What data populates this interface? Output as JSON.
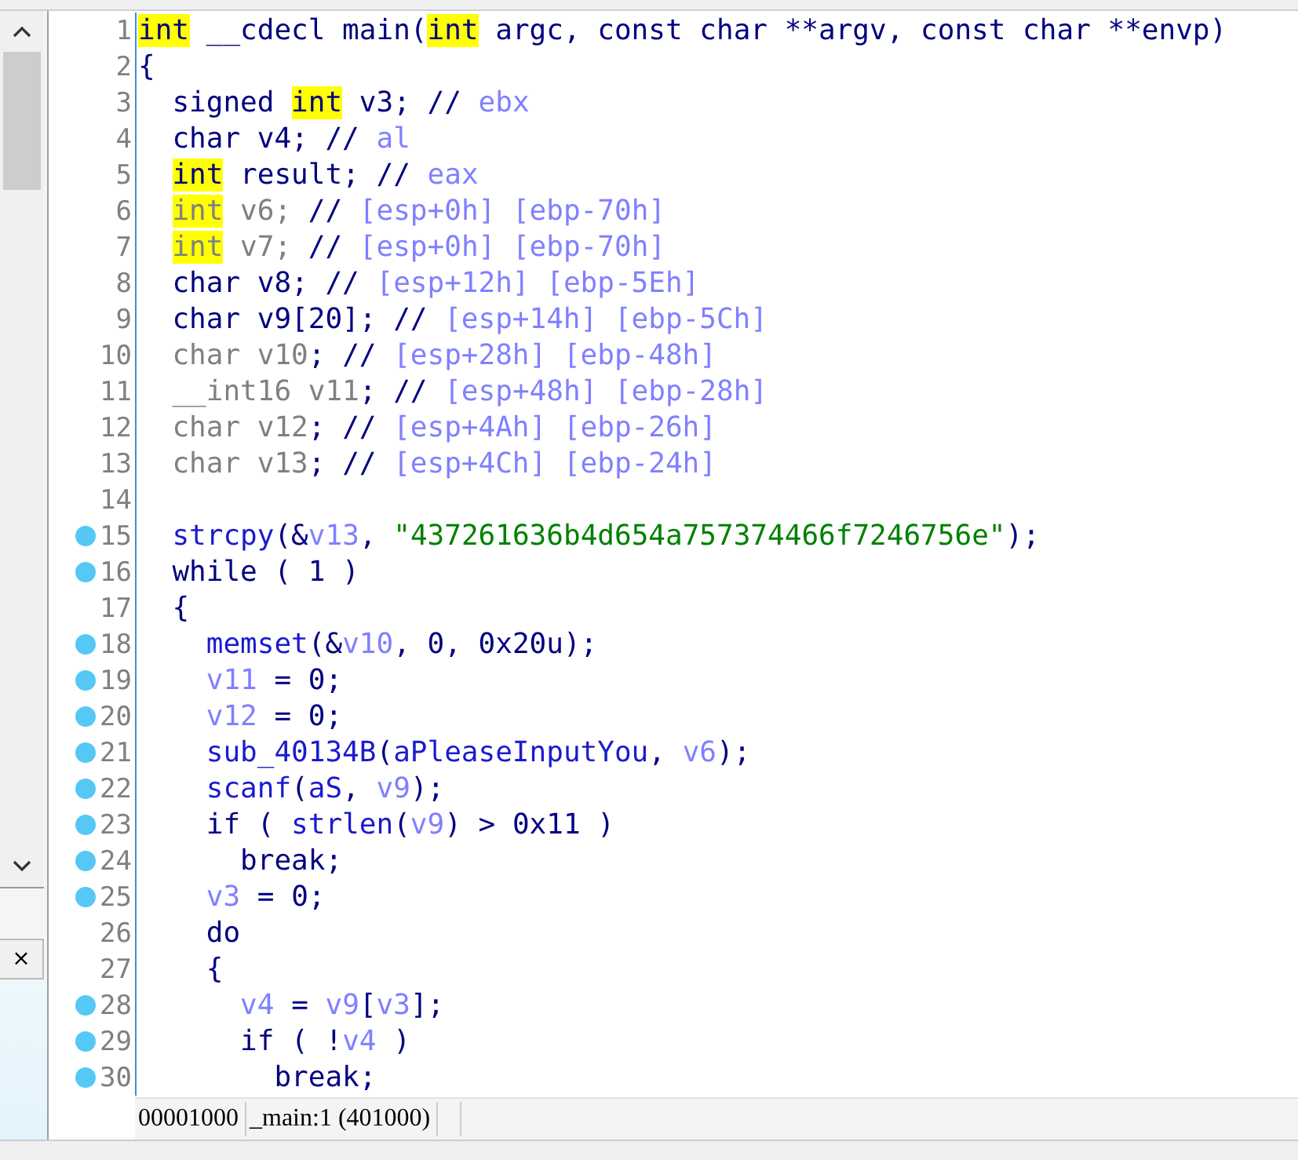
{
  "side_panel": {
    "close_label": "×"
  },
  "code_lines": [
    {
      "number": "1",
      "breakpoint": false,
      "tokens": [
        {
          "text": "int",
          "kind": "mark"
        },
        {
          "text": " __cdecl main(",
          "kind": "plain"
        },
        {
          "text": "int",
          "kind": "mark"
        },
        {
          "text": " argc, const char **argv, const char **envp)",
          "kind": "plain"
        }
      ]
    },
    {
      "number": "2",
      "breakpoint": false,
      "tokens": [
        {
          "text": "{",
          "kind": "plain"
        }
      ]
    },
    {
      "number": "3",
      "breakpoint": false,
      "tokens": [
        {
          "text": "  signed ",
          "kind": "plain"
        },
        {
          "text": "int",
          "kind": "mark"
        },
        {
          "text": " v3; // ",
          "kind": "plain"
        },
        {
          "text": "ebx",
          "kind": "comment"
        }
      ]
    },
    {
      "number": "4",
      "breakpoint": false,
      "tokens": [
        {
          "text": "  char v4; // ",
          "kind": "plain"
        },
        {
          "text": "al",
          "kind": "comment"
        }
      ]
    },
    {
      "number": "5",
      "breakpoint": false,
      "tokens": [
        {
          "text": "  int",
          "kind": "mark"
        },
        {
          "text": " result; // ",
          "kind": "plain"
        },
        {
          "text": "eax",
          "kind": "comment"
        }
      ]
    },
    {
      "number": "6",
      "breakpoint": false,
      "tokens": [
        {
          "text": "  int",
          "kind": "mark-dim"
        },
        {
          "text": " v6; ",
          "kind": "dim"
        },
        {
          "text": "// ",
          "kind": "plain"
        },
        {
          "text": "[esp+0h] [ebp-70h]",
          "kind": "comment"
        }
      ]
    },
    {
      "number": "7",
      "breakpoint": false,
      "tokens": [
        {
          "text": "  int",
          "kind": "mark-dim"
        },
        {
          "text": " v7; ",
          "kind": "dim"
        },
        {
          "text": "// ",
          "kind": "plain"
        },
        {
          "text": "[esp+0h] [ebp-70h]",
          "kind": "comment"
        }
      ]
    },
    {
      "number": "8",
      "breakpoint": false,
      "tokens": [
        {
          "text": "  char v8; // ",
          "kind": "plain"
        },
        {
          "text": "[esp+12h] [ebp-5Eh]",
          "kind": "comment"
        }
      ]
    },
    {
      "number": "9",
      "breakpoint": false,
      "tokens": [
        {
          "text": "  char v9[20]; // ",
          "kind": "plain"
        },
        {
          "text": "[esp+14h] [ebp-5Ch]",
          "kind": "comment"
        }
      ]
    },
    {
      "number": "10",
      "breakpoint": false,
      "tokens": [
        {
          "text": "  char v10",
          "kind": "dim"
        },
        {
          "text": "; // ",
          "kind": "plain"
        },
        {
          "text": "[esp+28h] [ebp-48h]",
          "kind": "comment"
        }
      ]
    },
    {
      "number": "11",
      "breakpoint": false,
      "tokens": [
        {
          "text": "  __int16 v11",
          "kind": "dim"
        },
        {
          "text": "; // ",
          "kind": "plain"
        },
        {
          "text": "[esp+48h] [ebp-28h]",
          "kind": "comment"
        }
      ]
    },
    {
      "number": "12",
      "breakpoint": false,
      "tokens": [
        {
          "text": "  char v12",
          "kind": "dim"
        },
        {
          "text": "; // ",
          "kind": "plain"
        },
        {
          "text": "[esp+4Ah] [ebp-26h]",
          "kind": "comment"
        }
      ]
    },
    {
      "number": "13",
      "breakpoint": false,
      "tokens": [
        {
          "text": "  char v13",
          "kind": "dim"
        },
        {
          "text": "; // ",
          "kind": "plain"
        },
        {
          "text": "[esp+4Ch] [ebp-24h]",
          "kind": "comment"
        }
      ]
    },
    {
      "number": "14",
      "breakpoint": false
    },
    {
      "number": "15",
      "breakpoint": true,
      "tokens": [
        {
          "text": "  strcpy",
          "kind": "func"
        },
        {
          "text": "(&",
          "kind": "plain"
        },
        {
          "text": "v13",
          "kind": "var"
        },
        {
          "text": ", ",
          "kind": "plain"
        },
        {
          "text": "\"437261636b4d654a757374466f7246756e\"",
          "kind": "string"
        },
        {
          "text": ");",
          "kind": "plain"
        }
      ]
    },
    {
      "number": "16",
      "breakpoint": true,
      "tokens": [
        {
          "text": "  while ( 1 )",
          "kind": "plain"
        }
      ]
    },
    {
      "number": "17",
      "breakpoint": false,
      "tokens": [
        {
          "text": "  {",
          "kind": "plain"
        }
      ]
    },
    {
      "number": "18",
      "breakpoint": true,
      "tokens": [
        {
          "text": "    memset",
          "kind": "func"
        },
        {
          "text": "(&",
          "kind": "plain"
        },
        {
          "text": "v10",
          "kind": "var"
        },
        {
          "text": ", 0, 0x20u);",
          "kind": "plain"
        }
      ]
    },
    {
      "number": "19",
      "breakpoint": true,
      "tokens": [
        {
          "text": "    v11",
          "kind": "var"
        },
        {
          "text": " = 0;",
          "kind": "plain"
        }
      ]
    },
    {
      "number": "20",
      "breakpoint": true,
      "tokens": [
        {
          "text": "    v12",
          "kind": "var"
        },
        {
          "text": " = 0;",
          "kind": "plain"
        }
      ]
    },
    {
      "number": "21",
      "breakpoint": true,
      "tokens": [
        {
          "text": "    sub_40134B",
          "kind": "func"
        },
        {
          "text": "(",
          "kind": "plain"
        },
        {
          "text": "aPleaseInputYou",
          "kind": "func"
        },
        {
          "text": ", ",
          "kind": "plain"
        },
        {
          "text": "v6",
          "kind": "var"
        },
        {
          "text": ");",
          "kind": "plain"
        }
      ]
    },
    {
      "number": "22",
      "breakpoint": true,
      "tokens": [
        {
          "text": "    scanf",
          "kind": "func"
        },
        {
          "text": "(",
          "kind": "plain"
        },
        {
          "text": "aS",
          "kind": "func"
        },
        {
          "text": ", ",
          "kind": "plain"
        },
        {
          "text": "v9",
          "kind": "var"
        },
        {
          "text": ");",
          "kind": "plain"
        }
      ]
    },
    {
      "number": "23",
      "breakpoint": true,
      "tokens": [
        {
          "text": "    if ( ",
          "kind": "plain"
        },
        {
          "text": "strlen",
          "kind": "func"
        },
        {
          "text": "(",
          "kind": "plain"
        },
        {
          "text": "v9",
          "kind": "var"
        },
        {
          "text": ") > 0x11 )",
          "kind": "plain"
        }
      ]
    },
    {
      "number": "24",
      "breakpoint": true,
      "tokens": [
        {
          "text": "      break;",
          "kind": "plain"
        }
      ]
    },
    {
      "number": "25",
      "breakpoint": true,
      "tokens": [
        {
          "text": "    v3",
          "kind": "var"
        },
        {
          "text": " = 0;",
          "kind": "plain"
        }
      ]
    },
    {
      "number": "26",
      "breakpoint": false,
      "tokens": [
        {
          "text": "    do",
          "kind": "plain"
        }
      ]
    },
    {
      "number": "27",
      "breakpoint": false,
      "tokens": [
        {
          "text": "    {",
          "kind": "plain"
        }
      ]
    },
    {
      "number": "28",
      "breakpoint": true,
      "tokens": [
        {
          "text": "      v4",
          "kind": "var"
        },
        {
          "text": " = ",
          "kind": "plain"
        },
        {
          "text": "v9",
          "kind": "var"
        },
        {
          "text": "[",
          "kind": "plain"
        },
        {
          "text": "v3",
          "kind": "var"
        },
        {
          "text": "];",
          "kind": "plain"
        }
      ]
    },
    {
      "number": "29",
      "breakpoint": true,
      "tokens": [
        {
          "text": "      if ( !",
          "kind": "plain"
        },
        {
          "text": "v4",
          "kind": "var"
        },
        {
          "text": " )",
          "kind": "plain"
        }
      ]
    },
    {
      "number": "30",
      "breakpoint": true,
      "tokens": [
        {
          "text": "        break;",
          "kind": "plain"
        }
      ]
    }
  ],
  "status_bar": {
    "address": "00001000",
    "location": "_main:1 (401000)"
  }
}
